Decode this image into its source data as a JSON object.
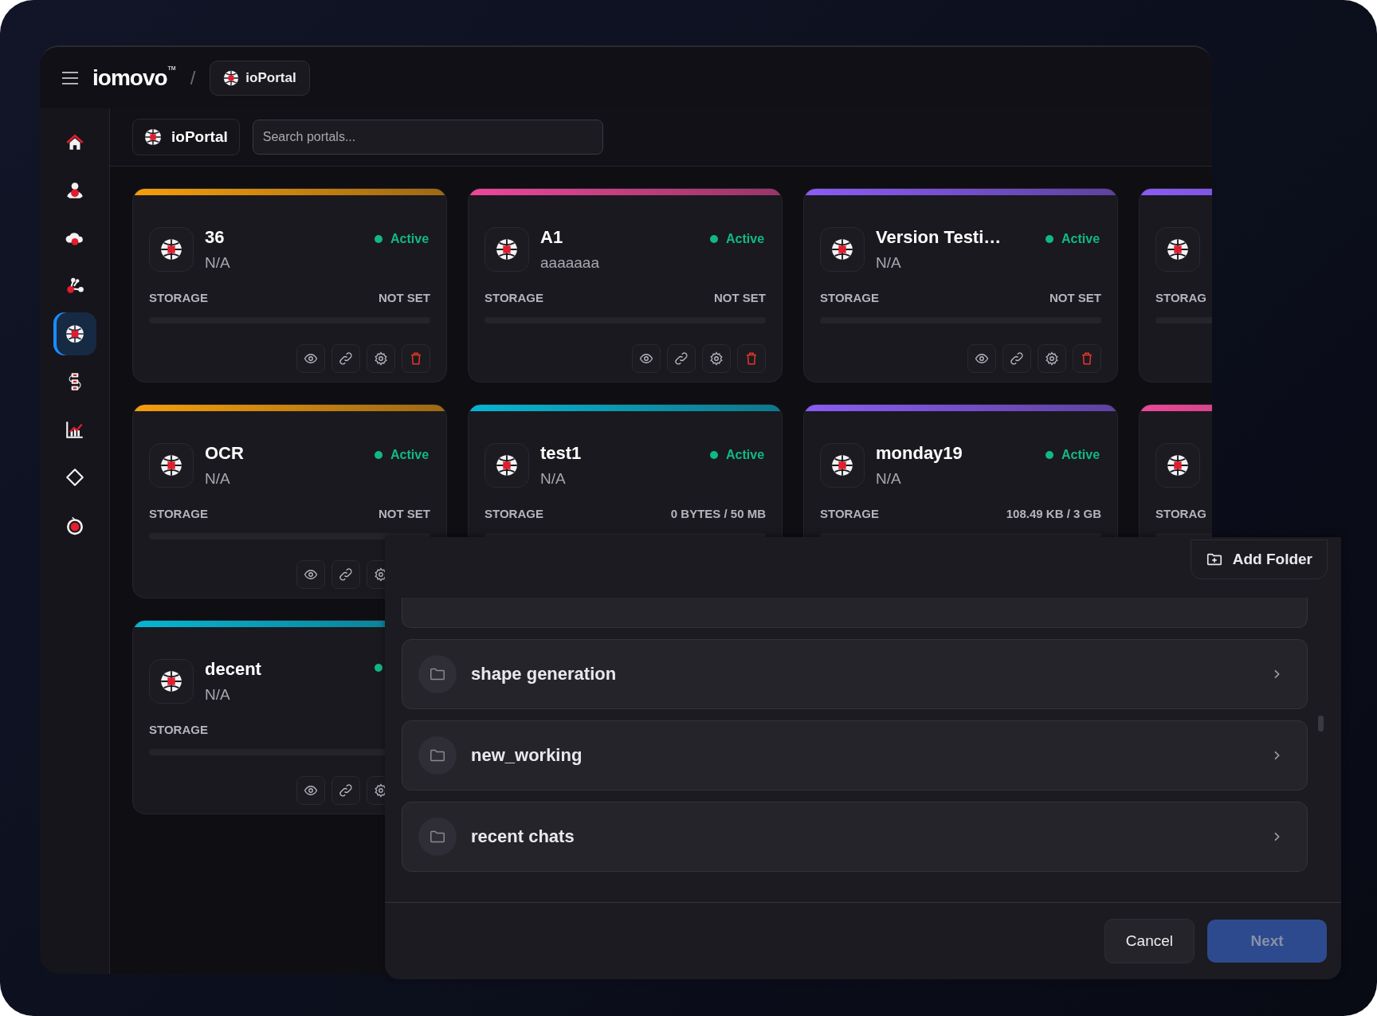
{
  "header": {
    "logo": "iomovo",
    "logo_mark": "TM",
    "separator": "/",
    "breadcrumb": "ioPortal"
  },
  "sidebar": {
    "items": [
      {
        "kind": "home",
        "selected": false
      },
      {
        "kind": "people",
        "selected": false
      },
      {
        "kind": "cloud",
        "selected": false
      },
      {
        "kind": "share",
        "selected": false
      },
      {
        "kind": "portal",
        "selected": true
      },
      {
        "kind": "workflow",
        "selected": false
      },
      {
        "kind": "chart",
        "selected": false
      },
      {
        "kind": "diamond",
        "selected": false
      },
      {
        "kind": "timer",
        "selected": false
      }
    ]
  },
  "toolbar": {
    "title": "ioPortal",
    "search": {
      "placeholder": "Search portals..."
    }
  },
  "cards": [
    {
      "color": "#f59e0b",
      "name": "36",
      "subtitle": "N/A",
      "status": {
        "label": "Active",
        "active": true
      },
      "storage_label": "STORAGE",
      "storage_value": "NOT SET",
      "actions": [
        {
          "kind": "view"
        },
        {
          "kind": "link"
        },
        {
          "kind": "settings"
        },
        {
          "kind": "delete"
        }
      ]
    },
    {
      "color": "#ec4899",
      "name": "A1",
      "subtitle": "aaaaaaa",
      "status": {
        "label": "Active",
        "active": true
      },
      "storage_label": "STORAGE",
      "storage_value": "NOT SET",
      "actions": [
        {
          "kind": "view"
        },
        {
          "kind": "link"
        },
        {
          "kind": "settings"
        },
        {
          "kind": "delete"
        }
      ]
    },
    {
      "color": "#8b5cf6",
      "name": "Version Testi…",
      "subtitle": "N/A",
      "status": {
        "label": "Active",
        "active": true
      },
      "storage_label": "STORAGE",
      "storage_value": "NOT SET",
      "actions": [
        {
          "kind": "view"
        },
        {
          "kind": "link"
        },
        {
          "kind": "settings"
        },
        {
          "kind": "delete"
        }
      ]
    },
    {
      "color": "#8b5cf6",
      "storage_label": "STORAG"
    },
    {
      "color": "#f59e0b",
      "name": "OCR",
      "subtitle": "N/A",
      "status": {
        "label": "Active",
        "active": true
      },
      "storage_label": "STORAGE",
      "storage_value": "NOT SET",
      "actions": [
        {
          "kind": "view"
        },
        {
          "kind": "link"
        },
        {
          "kind": "settings"
        }
      ]
    },
    {
      "color": "#06b6d4",
      "name": "test1",
      "subtitle": "N/A",
      "status": {
        "label": "Active",
        "active": true
      },
      "storage_label": "STORAGE",
      "storage_value": "0 BYTES / 50 MB"
    },
    {
      "color": "#8b5cf6",
      "name": "monday19",
      "subtitle": "N/A",
      "status": {
        "label": "Active",
        "active": true
      },
      "storage_label": "STORAGE",
      "storage_value": "108.49 KB / 3 GB"
    },
    {
      "color": "#ec4899",
      "storage_label": "STORAG"
    },
    {
      "color": "#06b6d4",
      "name": "decent",
      "subtitle": "N/A",
      "status": {
        "active": true
      },
      "storage_label": "STORAGE",
      "actions": [
        {
          "kind": "view"
        },
        {
          "kind": "link"
        },
        {
          "kind": "settings"
        }
      ]
    }
  ],
  "dialog": {
    "add_button": "Add Folder",
    "folders": [
      {
        "kind": "partial"
      },
      {
        "kind": "folder",
        "name": "shape generation"
      },
      {
        "kind": "folder",
        "name": "new_working"
      },
      {
        "kind": "folder",
        "name": "recent chats"
      }
    ],
    "cancel": "Cancel",
    "next": {
      "label": "Next",
      "disabled": true
    }
  }
}
